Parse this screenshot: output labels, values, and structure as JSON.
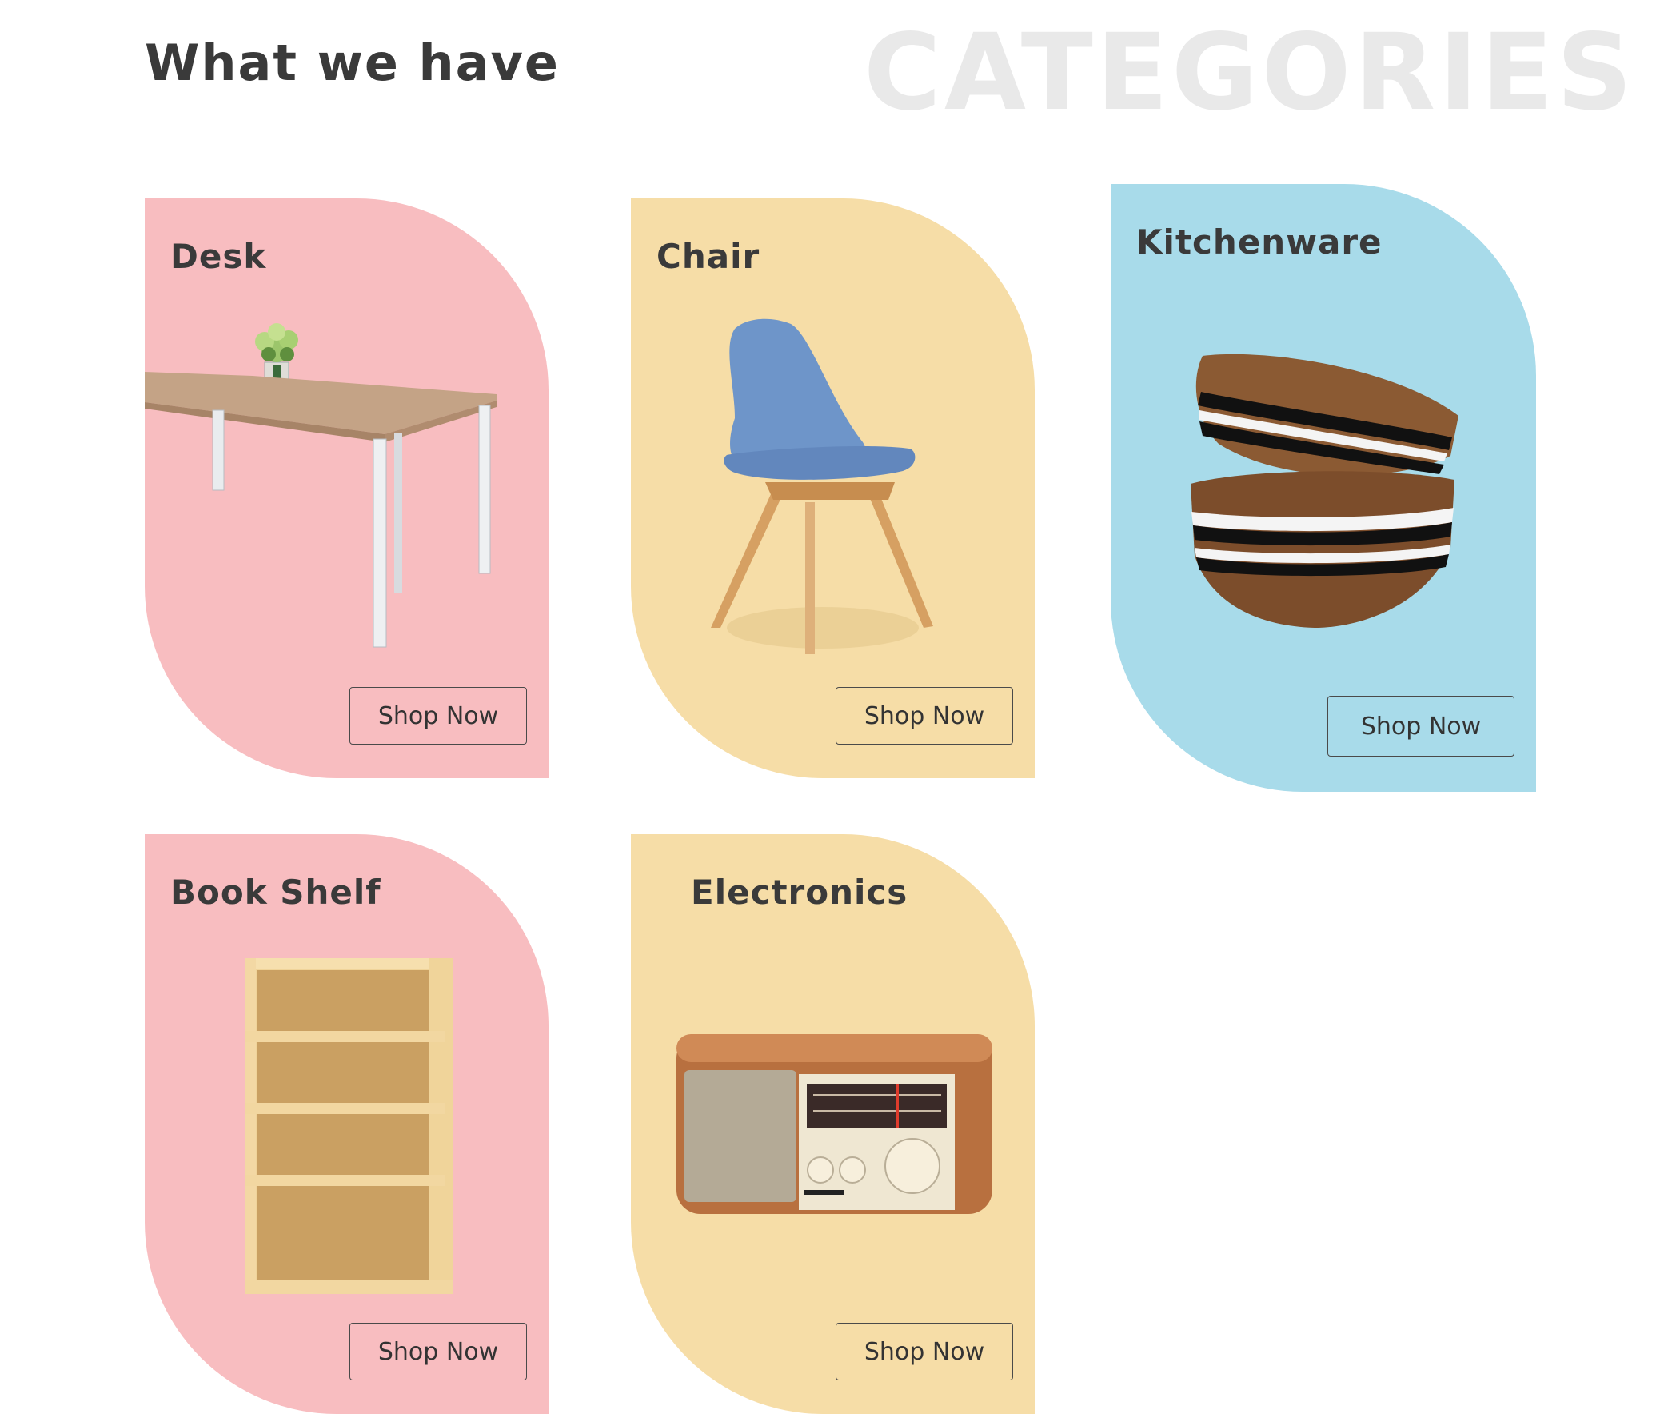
{
  "section": {
    "heading": "What we have",
    "background_word": "CATEGORIES"
  },
  "colors": {
    "pink": "#f8bdc0",
    "yellow": "#f6dda7",
    "blue": "#a8dbea"
  },
  "categories": [
    {
      "title": "Desk",
      "button": "Shop Now",
      "color": "pink",
      "image": "desk-image"
    },
    {
      "title": "Chair",
      "button": "Shop Now",
      "color": "yellow",
      "image": "chair-image"
    },
    {
      "title": "Kitchenware",
      "button": "Shop Now",
      "color": "blue",
      "image": "bowls-image"
    },
    {
      "title": "Book Shelf",
      "button": "Shop Now",
      "color": "pink",
      "image": "bookshelf-image"
    },
    {
      "title": "Electronics",
      "button": "Shop Now",
      "color": "yellow",
      "image": "radio-image"
    }
  ]
}
